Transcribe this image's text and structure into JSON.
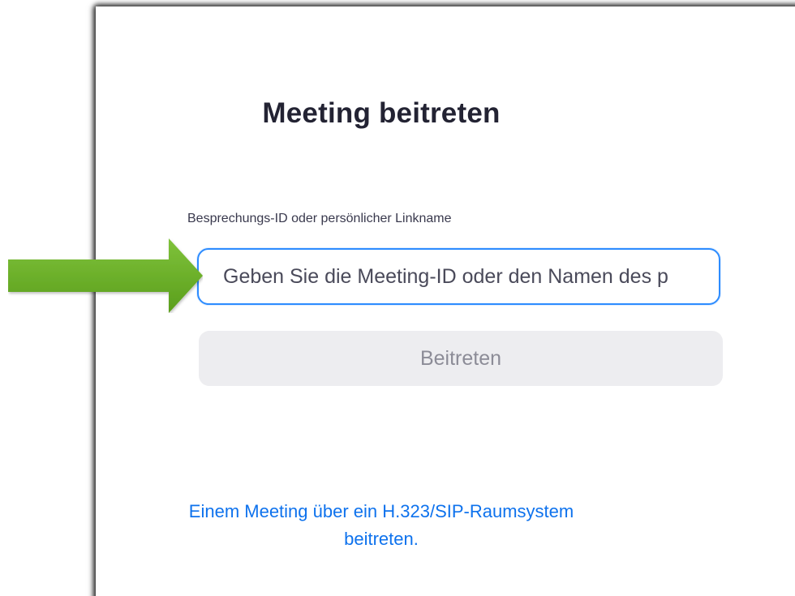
{
  "dialog": {
    "title": "Meeting beitreten",
    "field_label": "Besprechungs-ID oder persönlicher Linkname",
    "input_placeholder": "Geben Sie die Meeting-ID oder den Namen des p",
    "input_value": "",
    "join_button_label": "Beitreten",
    "join_button_enabled": false,
    "room_system_link_line1": "Einem Meeting über ein H.323/SIP-Raumsystem",
    "room_system_link_line2": "beitreten."
  },
  "annotation": {
    "icon": "green-arrow-icon",
    "color": "#6ab023"
  },
  "colors": {
    "accent": "#2d8cff",
    "link": "#0e72ed",
    "disabled_button_bg": "#ededf0",
    "disabled_button_text": "#8c8c97"
  }
}
